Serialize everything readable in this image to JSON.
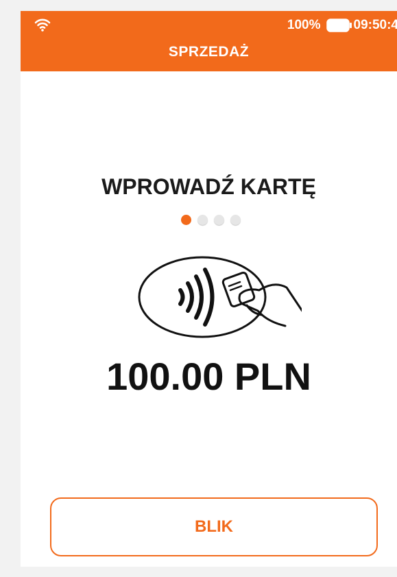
{
  "status_bar": {
    "battery_percent": "100%",
    "time": "09:50:4",
    "icons": [
      "wifi-icon",
      "battery-icon"
    ]
  },
  "header": {
    "title": "SPRZEDAŻ"
  },
  "main": {
    "instruction": "WPROWADŹ KARTĘ",
    "pagination": {
      "total": 4,
      "active_index": 0
    },
    "contactless_icon": "contactless-card-tap-icon",
    "amount": "100.00 PLN"
  },
  "actions": {
    "blik_label": "BLIK"
  },
  "colors": {
    "accent": "#f26a1b",
    "text": "#111111",
    "background": "#ffffff",
    "inactive_dot": "#e6e6e6"
  }
}
